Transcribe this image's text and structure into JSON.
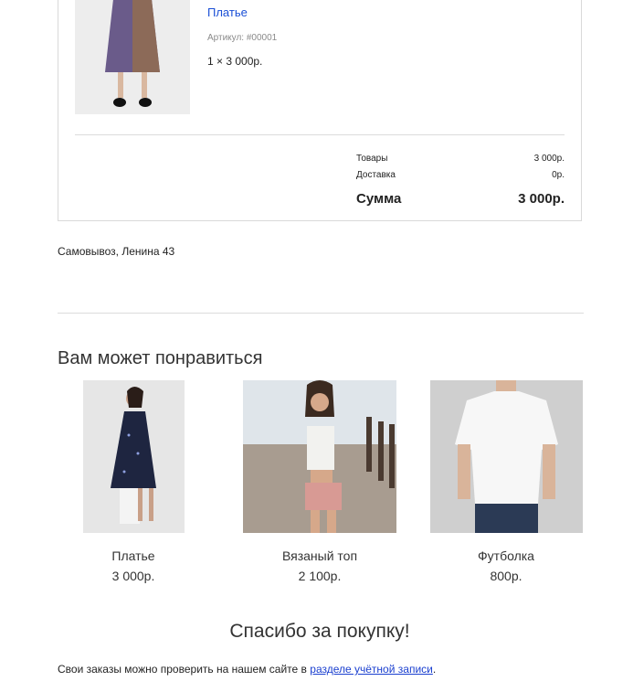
{
  "order": {
    "product": {
      "name": "Платье",
      "sku": "Артикул: #00001",
      "qty_line": "1 × 3 000р."
    },
    "totals": {
      "goods_label": "Товары",
      "goods_value": "3 000р.",
      "delivery_label": "Доставка",
      "delivery_value": "0р.",
      "sum_label": "Сумма",
      "sum_value": "3 000р."
    }
  },
  "pickup": "Самовывоз, Ленина 43",
  "recommendations": {
    "title": "Вам может понравиться",
    "items": [
      {
        "name": "Платье",
        "price": "3 000р."
      },
      {
        "name": "Вязаный топ",
        "price": "2 100р."
      },
      {
        "name": "Футболка",
        "price": "800р."
      }
    ]
  },
  "thanks": "Спасибо за покупку!",
  "footer": {
    "text_before": "Свои заказы можно проверить на нашем сайте в ",
    "link_label": "разделе учётной записи",
    "text_after": "."
  }
}
